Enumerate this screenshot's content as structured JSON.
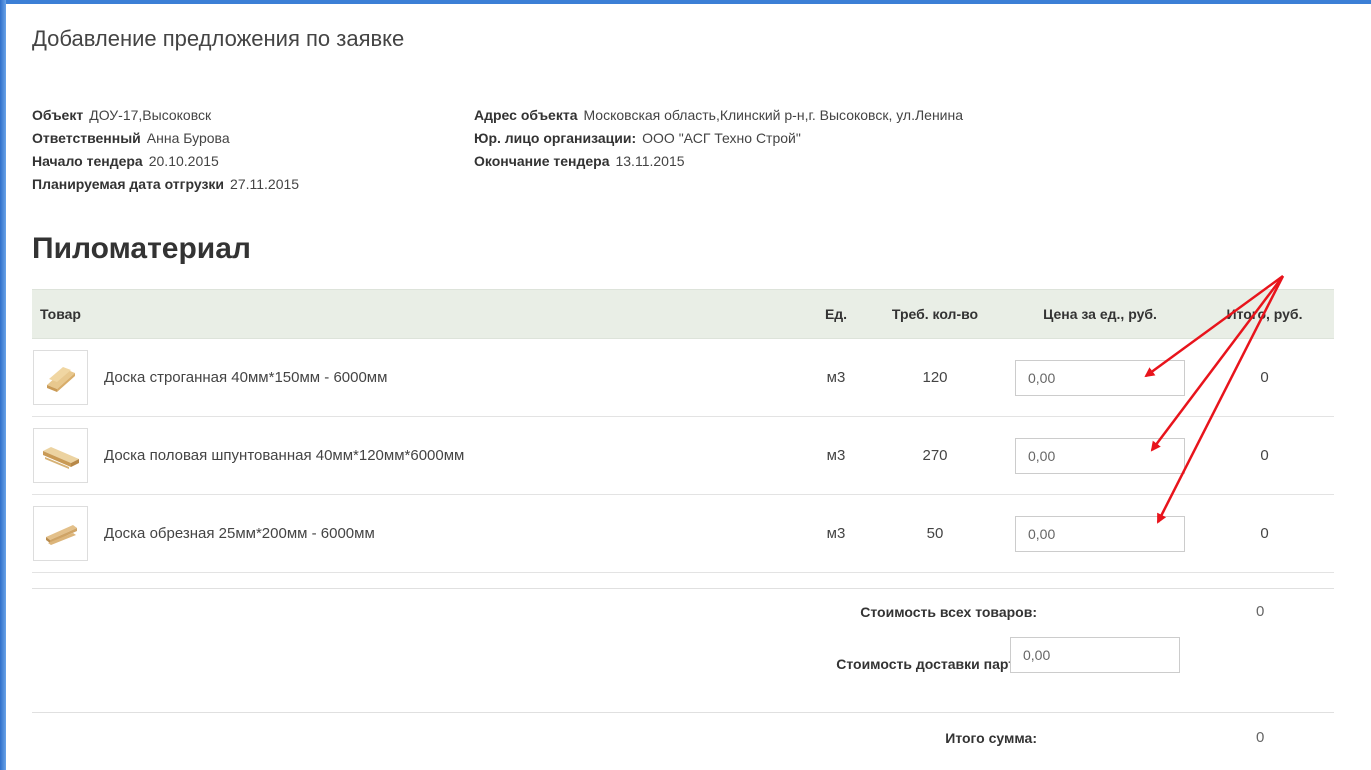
{
  "page": {
    "title": "Добавление предложения по заявке"
  },
  "info_left": [
    {
      "label": "Объект",
      "value": "ДОУ-17,Высоковск"
    },
    {
      "label": "Ответственный",
      "value": "Анна Бурова"
    },
    {
      "label": "Начало тендера",
      "value": "20.10.2015"
    },
    {
      "label": "Планируемая дата отгрузки",
      "value": "27.11.2015"
    }
  ],
  "info_right": [
    {
      "label": "Адрес объекта",
      "value": "Московская область,Клинский р-н,г. Высоковск, ул.Ленина"
    },
    {
      "label": "Юр. лицо организации:",
      "value": "ООО \"АСГ Техно Строй\""
    },
    {
      "label": "Окончание тендера",
      "value": "13.11.2015"
    }
  ],
  "section": {
    "title": "Пиломатериал"
  },
  "table": {
    "headers": [
      "Товар",
      "Ед.",
      "Треб. кол-во",
      "Цена за ед., руб.",
      "Итого, руб."
    ],
    "rows": [
      {
        "name": "Доска строганная 40мм*150мм - 6000мм",
        "unit": "м3",
        "qty": "120",
        "price": "0,00",
        "total": "0"
      },
      {
        "name": "Доска половая шпунтованная 40мм*120мм*6000мм",
        "unit": "м3",
        "qty": "270",
        "price": "0,00",
        "total": "0"
      },
      {
        "name": "Доска обрезная 25мм*200мм - 6000мм",
        "unit": "м3",
        "qty": "50",
        "price": "0,00",
        "total": "0"
      }
    ]
  },
  "summary": {
    "all_goods_label": "Стоимость всех товаров:",
    "all_goods_value": "0",
    "delivery_label": "Стоимость доставки партии:",
    "delivery_value": "0,00",
    "total_label": "Итого сумма:",
    "total_value": "0"
  },
  "colors": {
    "annotation_arrow": "#e8141c",
    "header_bg": "#e9eee6",
    "frame_accent": "#3c7fd6"
  },
  "icons": {
    "product_thumb": "wood-plank-icon"
  }
}
